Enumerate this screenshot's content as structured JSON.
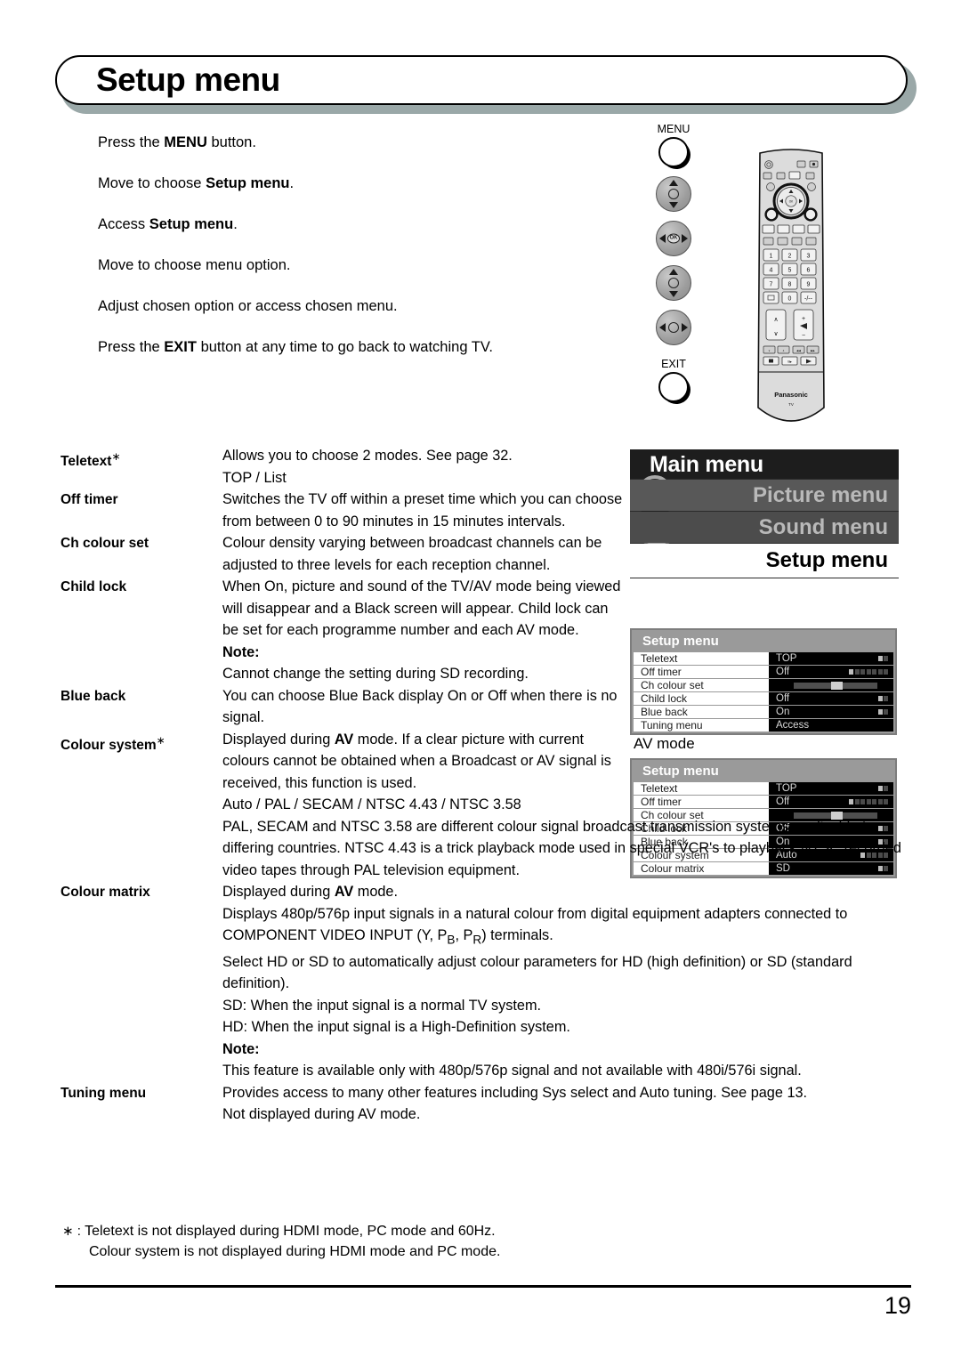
{
  "header": {
    "title": "Setup menu"
  },
  "steps": [
    {
      "id": "press-menu",
      "html": "Press the <b>MENU</b> button."
    },
    {
      "id": "move-choose-setup",
      "html": "Move to choose <b>Setup menu</b>."
    },
    {
      "id": "access-setup",
      "html": "Access <b>Setup menu</b>."
    },
    {
      "id": "move-choose-option",
      "html": "Move to choose menu option."
    },
    {
      "id": "adjust-option",
      "html": "Adjust chosen option or access chosen menu."
    },
    {
      "id": "press-exit",
      "html": "Press the <b>EXIT</b> button at any time to go back to watching TV."
    }
  ],
  "callouts": {
    "menu_label": "MENU",
    "exit_label": "EXIT",
    "ok_label": "OK"
  },
  "remote": {
    "brand": "Panasonic",
    "brand_sub": "TV",
    "keys": [
      "1",
      "2",
      "3",
      "4",
      "5",
      "6",
      "7",
      "8",
      "9",
      "0",
      "-/--"
    ]
  },
  "main_menu": {
    "title": "Main menu",
    "items": [
      {
        "label": "Picture menu",
        "selected": false
      },
      {
        "label": "Sound menu",
        "selected": false
      },
      {
        "label": "Setup menu",
        "selected": true
      }
    ]
  },
  "osd_tv": {
    "title": "Setup menu",
    "rows": [
      {
        "label": "Teletext",
        "value": "TOP",
        "indicator": "dots2"
      },
      {
        "label": "Off timer",
        "value": "Off",
        "indicator": "dots7"
      },
      {
        "label": "Ch colour set",
        "value": "",
        "indicator": "slider"
      },
      {
        "label": "Child lock",
        "value": "Off",
        "indicator": "dots2"
      },
      {
        "label": "Blue back",
        "value": "On",
        "indicator": "dots2"
      },
      {
        "label": "Tuning menu",
        "value": "Access",
        "indicator": "none"
      }
    ]
  },
  "osd_av": {
    "mode_label": "AV mode",
    "title": "Setup menu",
    "rows": [
      {
        "label": "Teletext",
        "value": "TOP",
        "indicator": "dots2"
      },
      {
        "label": "Off timer",
        "value": "Off",
        "indicator": "dots7"
      },
      {
        "label": "Ch colour set",
        "value": "",
        "indicator": "slider"
      },
      {
        "label": "Child lock",
        "value": "Off",
        "indicator": "dots2"
      },
      {
        "label": "Blue back",
        "value": "On",
        "indicator": "dots2"
      },
      {
        "label": "Colour system",
        "value": "Auto",
        "indicator": "dots5"
      },
      {
        "label": "Colour matrix",
        "value": "SD",
        "indicator": "dots2"
      }
    ]
  },
  "descriptions": [
    {
      "term": "Teletext",
      "asterisk": true,
      "width": "narrow",
      "body": "Allows you to choose 2 modes. See page 32.<br>TOP / List"
    },
    {
      "term": "Off timer",
      "asterisk": false,
      "width": "narrow",
      "body": "Switches the TV off within a preset time which you can choose from between 0 to 90 minutes in 15 minutes intervals."
    },
    {
      "term": "Ch colour set",
      "asterisk": false,
      "width": "narrow",
      "body": "Colour density varying between broadcast channels can be adjusted to three levels for each reception channel."
    },
    {
      "term": "Child lock",
      "asterisk": false,
      "width": "narrow",
      "body": "When On, picture and sound of the TV/AV mode being viewed will disappear and a Black screen will appear. Child lock can be set for each programme number and each AV mode.<br><span class=\"note\">Note:</span><br>Cannot change the setting during SD recording."
    },
    {
      "term": "Blue back",
      "asterisk": false,
      "width": "narrow",
      "body": "You can choose Blue Back display On or Off when there is no signal."
    },
    {
      "term": "Colour system",
      "asterisk": true,
      "width": "narrow",
      "body": "Displayed during <b>AV</b> mode. If a clear picture with current colours cannot be obtained when a Broadcast or AV signal is received, this function is used.<br>Auto / PAL / SECAM / NTSC 4.43 / NTSC 3.58"
    },
    {
      "term": "",
      "asterisk": false,
      "width": "wide",
      "body": "PAL, SECAM and NTSC 3.58 are different colour signal broadcast transmission systems applicable to differing countries. NTSC 4.43 is a trick playback mode used in special VCR's to playback NTSC recorded video tapes through PAL television equipment."
    },
    {
      "term": "Colour matrix",
      "asterisk": false,
      "width": "wide",
      "body": "Displayed during <b>AV</b> mode.<br>Displays 480p/576p input signals in a natural colour from digital equipment adapters connected to COMPONENT VIDEO INPUT (Y, P<sub>B</sub>, P<sub>R</sub>) terminals.<br>Select HD or SD to automatically adjust colour parameters for HD (high definition) or SD (standard definition).<br>SD: When the input signal is a normal TV system.<br>HD: When the input signal is a High-Definition system.<br><span class=\"note\">Note:</span><br>This feature is available only with 480p/576p signal and not available with 480i/576i signal."
    },
    {
      "term": "Tuning menu",
      "asterisk": false,
      "width": "wide",
      "body": "Provides access to many other features including Sys select and Auto tuning. See page 13.<br>Not displayed during AV mode."
    }
  ],
  "footnote": {
    "marker": "∗ :",
    "line1": "Teletext is not displayed during HDMI mode, PC mode and 60Hz.",
    "line2": "Colour system is not displayed during HDMI mode and PC mode."
  },
  "footer": {
    "page_number": "19"
  }
}
